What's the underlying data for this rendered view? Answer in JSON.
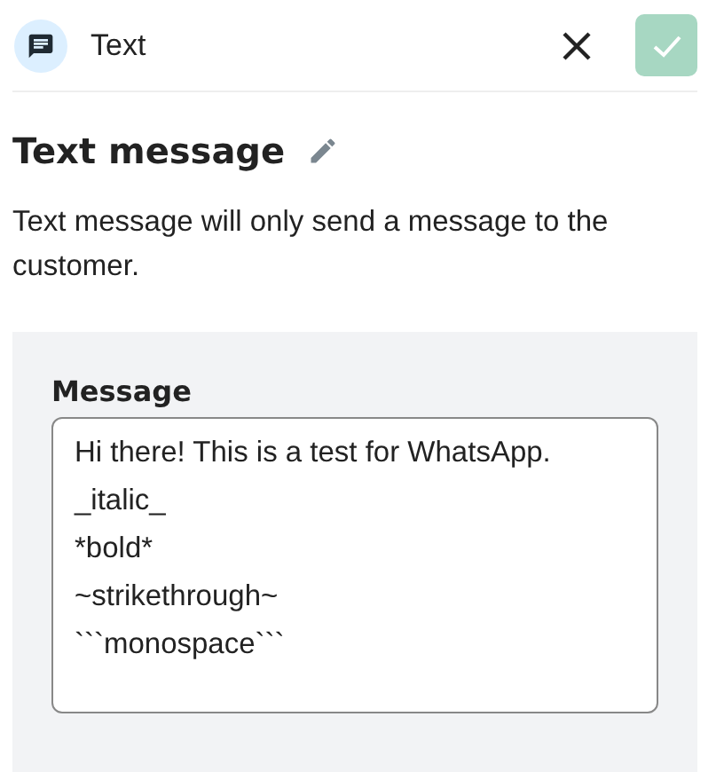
{
  "header": {
    "title": "Text",
    "confirm_disabled": true
  },
  "heading": "Text message",
  "description": "Text message will only send a message to the customer.",
  "message_field": {
    "label": "Message",
    "value": "Hi there! This is a test for WhatsApp.\n_italic_\n*bold*\n~strikethrough~\n```monospace```"
  }
}
